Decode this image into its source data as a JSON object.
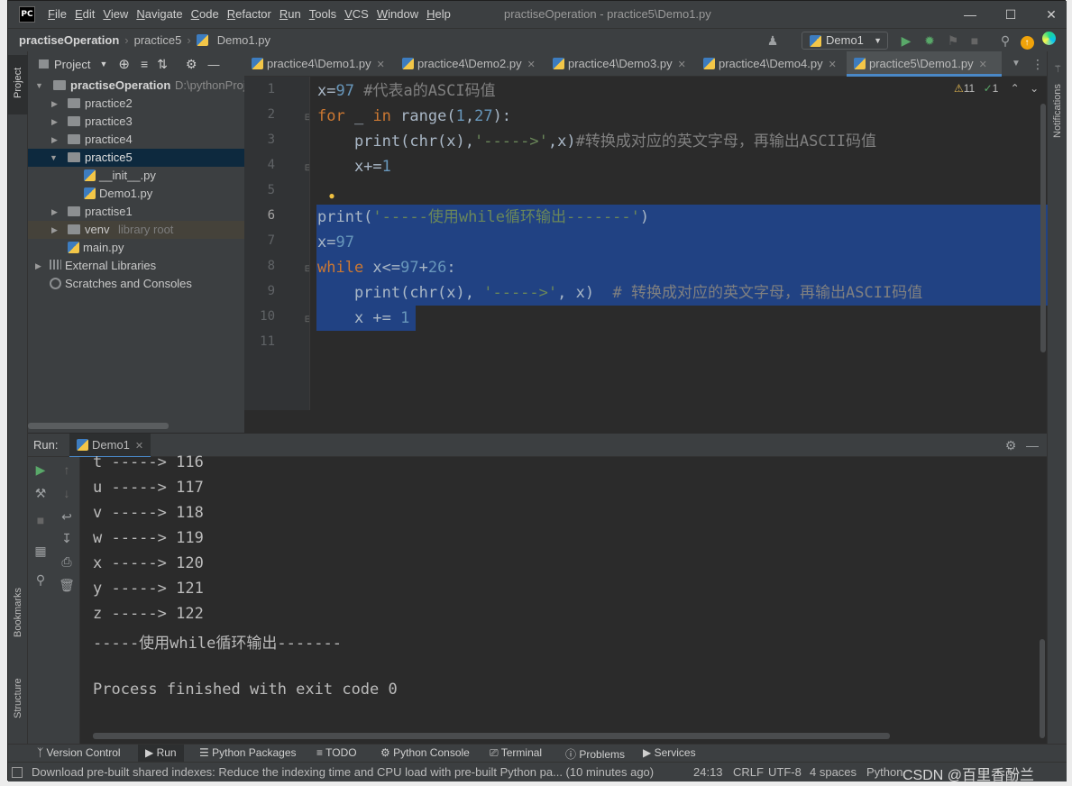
{
  "app": {
    "logo": "PC",
    "window_title": "practiseOperation - practice5\\Demo1.py",
    "menu": [
      "File",
      "Edit",
      "View",
      "Navigate",
      "Code",
      "Refactor",
      "Run",
      "Tools",
      "VCS",
      "Window",
      "Help"
    ]
  },
  "navbar": {
    "crumb_root": "practiseOperation",
    "crumb_dir": "practice5",
    "crumb_file": "Demo1.py",
    "run_config": "Demo1"
  },
  "project": {
    "header": "Project",
    "root_name": "practiseOperation",
    "root_path": "D:\\pythonProj",
    "items": [
      {
        "label": "practice2",
        "kind": "folder",
        "depth": 1
      },
      {
        "label": "practice3",
        "kind": "folder",
        "depth": 1
      },
      {
        "label": "practice4",
        "kind": "folder",
        "depth": 1
      },
      {
        "label": "practice5",
        "kind": "folder",
        "depth": 1,
        "selected": true
      },
      {
        "label": "__init__.py",
        "kind": "py",
        "depth": 2
      },
      {
        "label": "Demo1.py",
        "kind": "py",
        "depth": 2
      },
      {
        "label": "practise1",
        "kind": "folder",
        "depth": 1
      },
      {
        "label": "venv",
        "kind": "folder",
        "depth": 1,
        "note": "library root"
      },
      {
        "label": "main.py",
        "kind": "py",
        "depth": 1
      },
      {
        "label": "External Libraries",
        "kind": "lib",
        "depth": 0
      },
      {
        "label": "Scratches and Consoles",
        "kind": "scratch",
        "depth": 0
      }
    ]
  },
  "tabs": [
    "practice4\\Demo1.py",
    "practice4\\Demo2.py",
    "practice4\\Demo3.py",
    "practice4\\Demo4.py",
    "practice5\\Demo1.py"
  ],
  "editor": {
    "line_numbers": [
      "1",
      "2",
      "3",
      "4",
      "5",
      "6",
      "7",
      "8",
      "9",
      "10",
      "11"
    ],
    "inspections": {
      "warnings": "11",
      "ok": "1"
    }
  },
  "run": {
    "label": "Run:",
    "tab": "Demo1",
    "output": [
      "t -----> 116",
      "u -----> 117",
      "v -----> 118",
      "w -----> 119",
      "x -----> 120",
      "y -----> 121",
      "z -----> 122",
      "-----使用while循环输出-------",
      "",
      "Process finished with exit code 0"
    ]
  },
  "toolwindows": {
    "left": [
      "Project",
      "Bookmarks",
      "Structure"
    ],
    "right": [
      "Notifications"
    ],
    "bottom": [
      "Version Control",
      "Run",
      "Python Packages",
      "TODO",
      "Python Console",
      "Terminal",
      "Problems",
      "Services"
    ]
  },
  "status": {
    "message": "Download pre-built shared indexes: Reduce the indexing time and CPU load with pre-built Python pa... (10 minutes ago)",
    "position": "24:13",
    "line_sep": "CRLF",
    "encoding": "UTF-8",
    "indent": "4 spaces",
    "interpreter": "Python",
    "watermark": "CSDN @百里香酚兰"
  }
}
